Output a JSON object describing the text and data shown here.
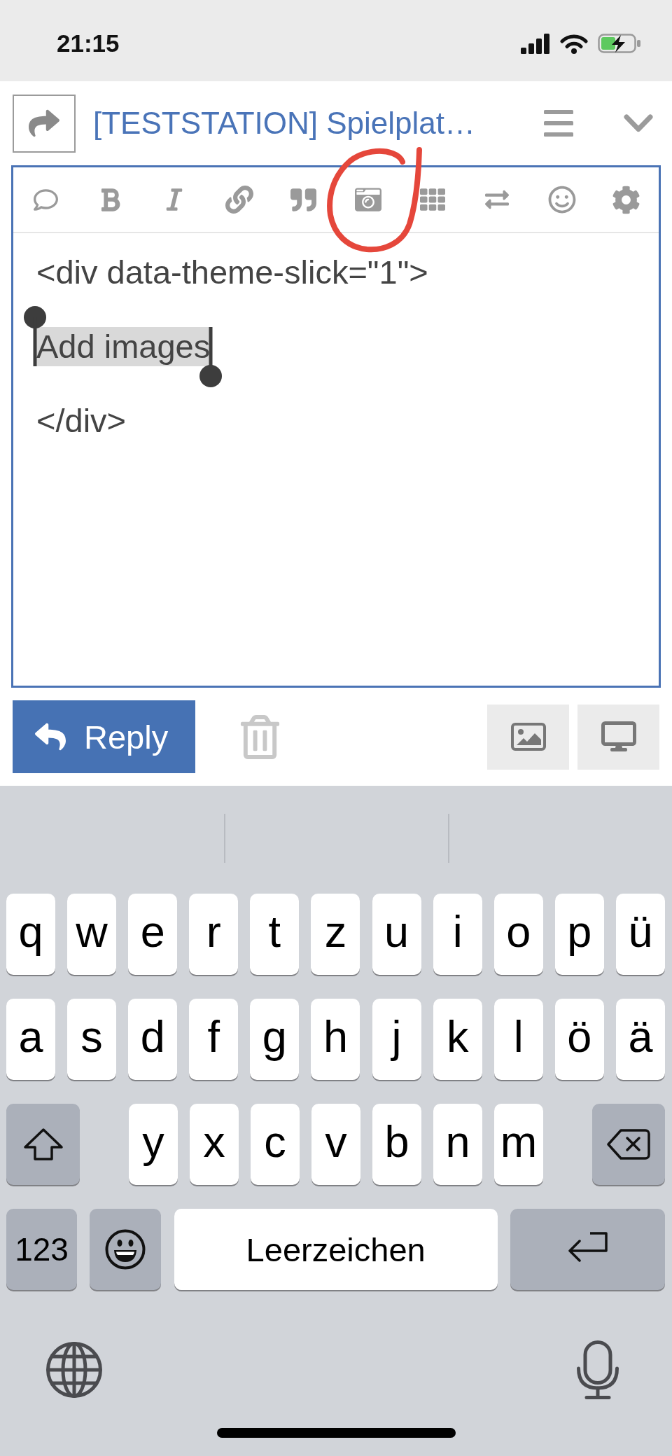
{
  "status_bar": {
    "time": "21:15"
  },
  "header": {
    "title": "[TESTSTATION] Spielplat…"
  },
  "editor": {
    "toolbar": [
      {
        "circled": false
      },
      {
        "circled": false
      },
      {
        "circled": false
      },
      {
        "circled": false
      },
      {
        "circled": false
      },
      {
        "circled": true
      },
      {
        "circled": false
      },
      {
        "circled": false
      },
      {
        "circled": false
      },
      {
        "circled": false
      }
    ],
    "paragraphs": [
      {
        "text": "<div data-theme-slick=\"1\">",
        "selected": false
      },
      {
        "text": "Add images",
        "selected": true
      },
      {
        "text": "</div>",
        "selected": false
      }
    ]
  },
  "actions": {
    "reply": "Reply"
  },
  "keyboard": {
    "rows": [
      {
        "keys": [
          "q",
          "w",
          "e",
          "r",
          "t",
          "z",
          "u",
          "i",
          "o",
          "p",
          "ü"
        ]
      },
      {
        "keys": [
          "a",
          "s",
          "d",
          "f",
          "g",
          "h",
          "j",
          "k",
          "l",
          "ö",
          "ä"
        ]
      },
      {
        "keys": [
          "y",
          "x",
          "c",
          "v",
          "b",
          "n",
          "m"
        ]
      }
    ],
    "numbers_key": "123",
    "space_key": "Leerzeichen"
  }
}
